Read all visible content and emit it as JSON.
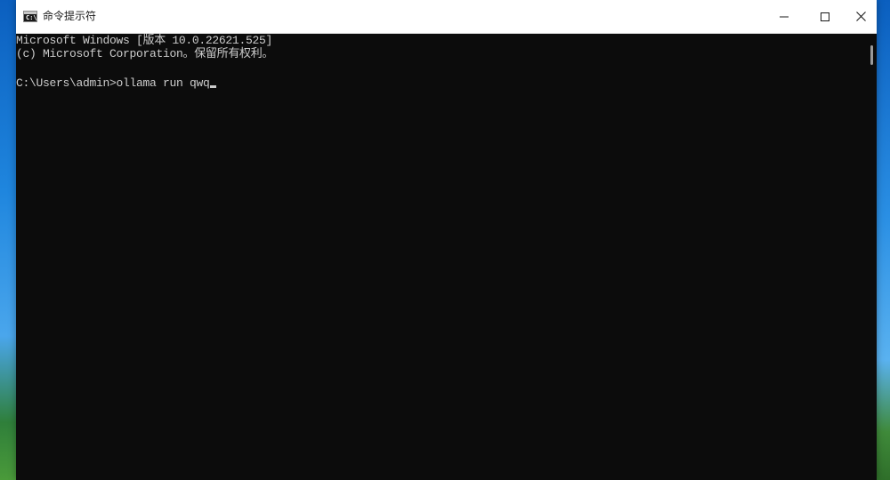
{
  "window": {
    "title": "命令提示符",
    "icon": "cmd-icon",
    "icon_glyph": "C:\\"
  },
  "controls": {
    "minimize_icon": "minimize-icon",
    "maximize_icon": "maximize-icon",
    "close_icon": "close-icon"
  },
  "console": {
    "line1": "Microsoft Windows [版本 10.0.22621.525]",
    "line2": "(c) Microsoft Corporation。保留所有权利。",
    "prompt": "C:\\Users\\admin>",
    "command": "ollama run qwq"
  },
  "colors": {
    "console_bg": "#0c0c0c",
    "console_text": "#cccccc",
    "titlebar_bg": "#ffffff"
  }
}
